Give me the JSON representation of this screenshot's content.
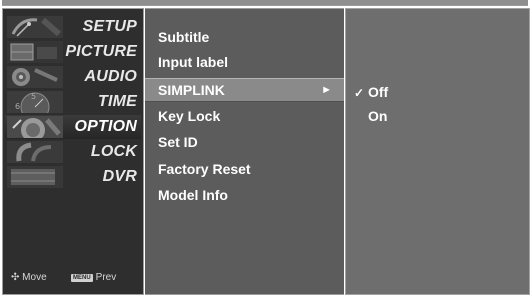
{
  "categories": [
    {
      "label": "SETUP",
      "icon": "satellite-dish-icon",
      "active": false
    },
    {
      "label": "PICTURE",
      "icon": "picture-reel-icon",
      "active": false
    },
    {
      "label": "AUDIO",
      "icon": "speaker-icon",
      "active": false
    },
    {
      "label": "TIME",
      "icon": "clock-icon",
      "active": false
    },
    {
      "label": "OPTION",
      "icon": "option-dial-icon",
      "active": true
    },
    {
      "label": "LOCK",
      "icon": "lock-icon",
      "active": false
    },
    {
      "label": "DVR",
      "icon": "film-reel-icon",
      "active": false
    }
  ],
  "hints": {
    "move_label": "Move",
    "menu_key": "MENU",
    "prev_label": "Prev"
  },
  "menu": {
    "items": [
      {
        "label": "Subtitle"
      },
      {
        "label": "Input label"
      },
      {
        "label": "SIMPLINK",
        "selected": true
      },
      {
        "label": "Key Lock"
      },
      {
        "label": "Set ID"
      },
      {
        "label": "Factory Reset"
      },
      {
        "label": "Model Info"
      }
    ],
    "arrow_glyph": "►"
  },
  "submenu": {
    "check_glyph": "✓",
    "options": [
      {
        "label": "Off",
        "checked": true
      },
      {
        "label": "On",
        "checked": false
      }
    ]
  },
  "colors": {
    "category_bg": "#2e2e2e",
    "menu_bg": "#5c5c5c",
    "menu_selected_bg": "#8a8a8a",
    "submenu_bg": "#6e6e6e",
    "text": "#ffffff"
  }
}
